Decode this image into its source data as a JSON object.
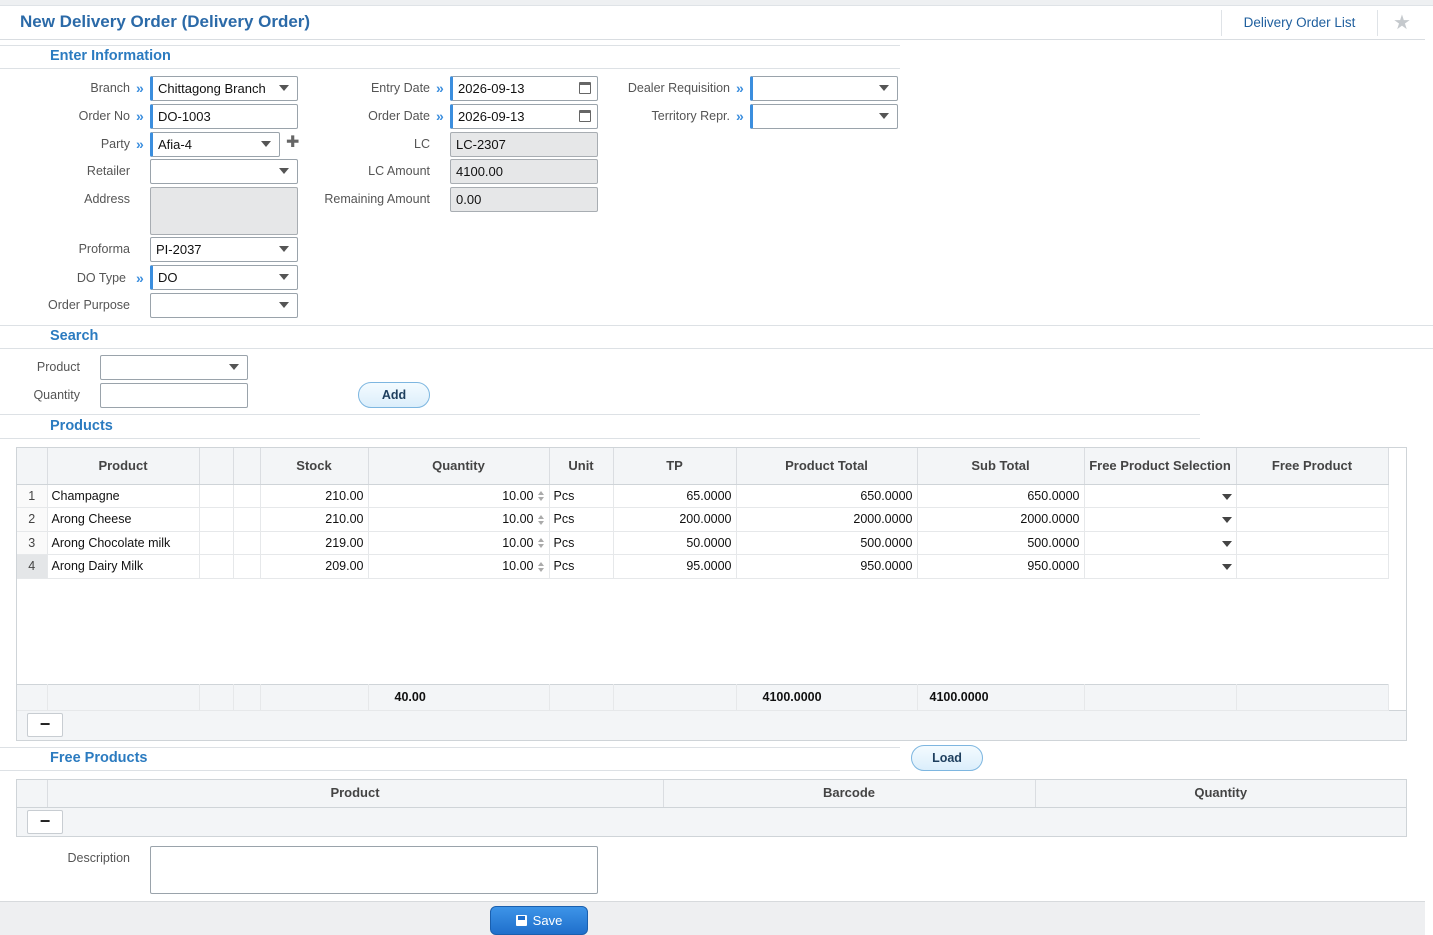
{
  "header": {
    "title": "New Delivery Order (Delivery Order)",
    "list_link": "Delivery Order List",
    "star_icon": "star-icon"
  },
  "sections": {
    "enter_information": "Enter Information",
    "search": "Search",
    "products": "Products",
    "free_products": "Free Products"
  },
  "form": {
    "branch": {
      "label": "Branch",
      "value": "Chittagong Branch"
    },
    "order_no": {
      "label": "Order No",
      "value": "DO-1003"
    },
    "party": {
      "label": "Party",
      "value": "Afia-4"
    },
    "retailer": {
      "label": "Retailer",
      "value": ""
    },
    "address": {
      "label": "Address",
      "value": ""
    },
    "proforma": {
      "label": "Proforma",
      "value": "PI-2037"
    },
    "do_type": {
      "label": "DO Type",
      "value": "DO"
    },
    "order_purpose": {
      "label": "Order Purpose",
      "value": ""
    },
    "entry_date": {
      "label": "Entry Date",
      "value": "2026-09-13"
    },
    "order_date": {
      "label": "Order Date",
      "value": "2026-09-13"
    },
    "lc": {
      "label": "LC",
      "value": "LC-2307"
    },
    "lc_amount": {
      "label": "LC Amount",
      "value": "4100.00"
    },
    "remaining_amount": {
      "label": "Remaining Amount",
      "value": "0.00"
    },
    "dealer_requisition": {
      "label": "Dealer Requisition",
      "value": ""
    },
    "territory_repr": {
      "label": "Territory Repr.",
      "value": ""
    }
  },
  "search": {
    "product": {
      "label": "Product",
      "value": ""
    },
    "quantity": {
      "label": "Quantity",
      "value": ""
    },
    "add_label": "Add"
  },
  "products_table": {
    "columns": [
      "Product",
      "Stock",
      "Quantity",
      "Unit",
      "TP",
      "Product Total",
      "Sub Total",
      "Free Product Selection",
      "Free Product"
    ],
    "rows": [
      {
        "n": "1",
        "product": "Champagne",
        "stock": "210.00",
        "quantity": "10.00",
        "unit": "Pcs",
        "tp": "65.0000",
        "product_total": "650.0000",
        "sub_total": "650.0000"
      },
      {
        "n": "2",
        "product": "Arong Cheese",
        "stock": "210.00",
        "quantity": "10.00",
        "unit": "Pcs",
        "tp": "200.0000",
        "product_total": "2000.0000",
        "sub_total": "2000.0000"
      },
      {
        "n": "3",
        "product": "Arong Chocolate milk",
        "stock": "219.00",
        "quantity": "10.00",
        "unit": "Pcs",
        "tp": "50.0000",
        "product_total": "500.0000",
        "sub_total": "500.0000"
      },
      {
        "n": "4",
        "product": "Arong Dairy Milk",
        "stock": "209.00",
        "quantity": "10.00",
        "unit": "Pcs",
        "tp": "95.0000",
        "product_total": "950.0000",
        "sub_total": "950.0000"
      }
    ],
    "totals": {
      "quantity": "40.00",
      "product_total": "4100.0000",
      "sub_total": "4100.0000"
    },
    "remove_label": "−"
  },
  "free_products_table": {
    "load_label": "Load",
    "columns": [
      "Product",
      "Barcode",
      "Quantity"
    ],
    "remove_label": "−"
  },
  "description": {
    "label": "Description",
    "value": ""
  },
  "save_label": "Save",
  "colors": {
    "accent": "#2b7bc0",
    "primary_button": "#1f6fcb"
  }
}
